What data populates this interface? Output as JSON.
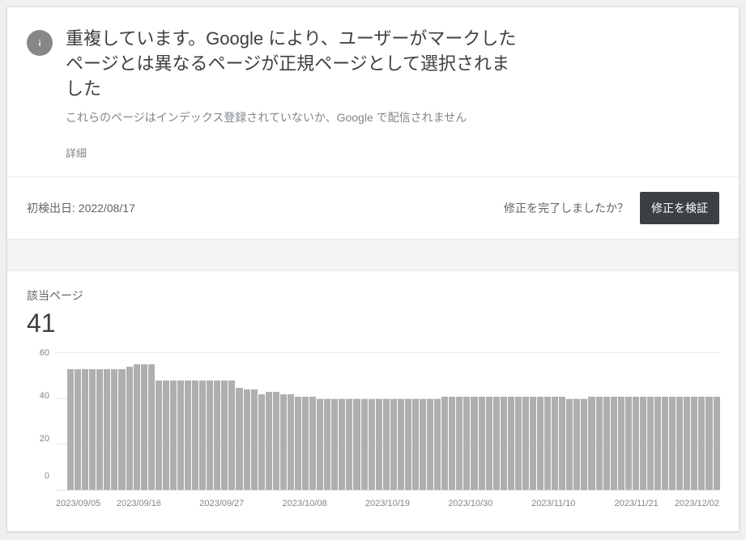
{
  "header": {
    "title": "重複しています。Google により、ユーザーがマークしたページとは異なるページが正規ページとして選択されました",
    "subtitle": "これらのページはインデックス登録されていないか、Google で配信されません",
    "details_link": "詳細"
  },
  "meta": {
    "first_detected_label": "初検出日:",
    "first_detected_value": "2022/08/17",
    "fix_question": "修正を完了しましたか？",
    "validate_button": "修正を検証"
  },
  "stats": {
    "label": "該当ページ",
    "value": "41"
  },
  "chart_data": {
    "type": "bar",
    "title": "",
    "xlabel": "",
    "ylabel": "",
    "ylim": [
      0,
      60
    ],
    "y_ticks": [
      60,
      40,
      20,
      0
    ],
    "x_ticks": [
      "2023/09/05",
      "2023/09/16",
      "2023/09/27",
      "2023/10/08",
      "2023/10/19",
      "2023/10/30",
      "2023/11/10",
      "2023/11/21",
      "2023/12/02"
    ],
    "categories": [
      "2023/09/05",
      "2023/09/06",
      "2023/09/07",
      "2023/09/08",
      "2023/09/09",
      "2023/09/10",
      "2023/09/11",
      "2023/09/12",
      "2023/09/13",
      "2023/09/14",
      "2023/09/15",
      "2023/09/16",
      "2023/09/17",
      "2023/09/18",
      "2023/09/19",
      "2023/09/20",
      "2023/09/21",
      "2023/09/22",
      "2023/09/23",
      "2023/09/24",
      "2023/09/25",
      "2023/09/26",
      "2023/09/27",
      "2023/09/28",
      "2023/09/29",
      "2023/09/30",
      "2023/10/01",
      "2023/10/02",
      "2023/10/03",
      "2023/10/04",
      "2023/10/05",
      "2023/10/06",
      "2023/10/07",
      "2023/10/08",
      "2023/10/09",
      "2023/10/10",
      "2023/10/11",
      "2023/10/12",
      "2023/10/13",
      "2023/10/14",
      "2023/10/15",
      "2023/10/16",
      "2023/10/17",
      "2023/10/18",
      "2023/10/19",
      "2023/10/20",
      "2023/10/21",
      "2023/10/22",
      "2023/10/23",
      "2023/10/24",
      "2023/10/25",
      "2023/10/26",
      "2023/10/27",
      "2023/10/28",
      "2023/10/29",
      "2023/10/30",
      "2023/10/31",
      "2023/11/01",
      "2023/11/02",
      "2023/11/03",
      "2023/11/04",
      "2023/11/05",
      "2023/11/06",
      "2023/11/07",
      "2023/11/08",
      "2023/11/09",
      "2023/11/10",
      "2023/11/11",
      "2023/11/12",
      "2023/11/13",
      "2023/11/14",
      "2023/11/15",
      "2023/11/16",
      "2023/11/17",
      "2023/11/18",
      "2023/11/19",
      "2023/11/20",
      "2023/11/21",
      "2023/11/22",
      "2023/11/23",
      "2023/11/24",
      "2023/11/25",
      "2023/11/26",
      "2023/11/27",
      "2023/11/28",
      "2023/11/29",
      "2023/11/30",
      "2023/12/01",
      "2023/12/02"
    ],
    "values": [
      53,
      53,
      53,
      53,
      53,
      53,
      53,
      53,
      54,
      55,
      55,
      55,
      48,
      48,
      48,
      48,
      48,
      48,
      48,
      48,
      48,
      48,
      48,
      45,
      44,
      44,
      42,
      43,
      43,
      42,
      42,
      41,
      41,
      41,
      40,
      40,
      40,
      40,
      40,
      40,
      40,
      40,
      40,
      40,
      40,
      40,
      40,
      40,
      40,
      40,
      40,
      41,
      41,
      41,
      41,
      41,
      41,
      41,
      41,
      41,
      41,
      41,
      41,
      41,
      41,
      41,
      41,
      41,
      40,
      40,
      40,
      41,
      41,
      41,
      41,
      41,
      41,
      41,
      41,
      41,
      41,
      41,
      41,
      41,
      41,
      41,
      41,
      41,
      41
    ]
  }
}
